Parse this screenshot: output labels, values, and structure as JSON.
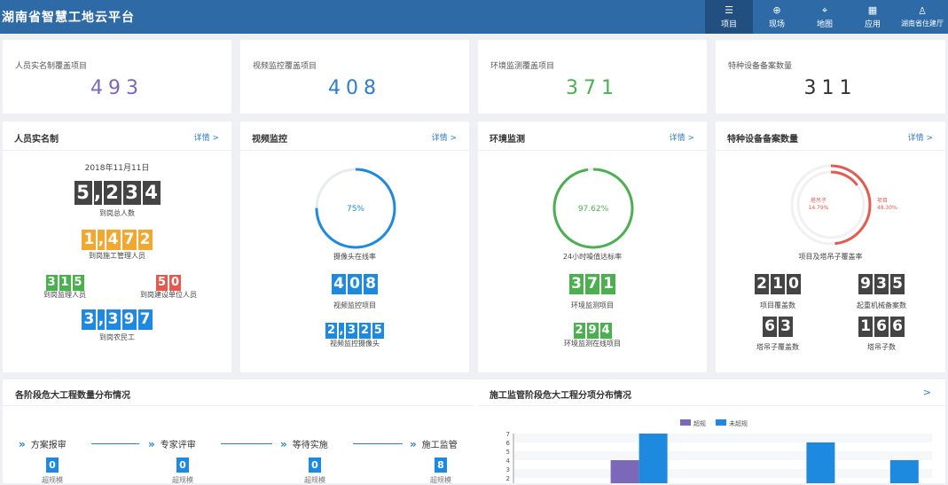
{
  "header": {
    "title": "湖南省智慧工地云平台"
  },
  "nav": [
    {
      "label": "项目",
      "icon": "list-icon",
      "glyph": "☰",
      "active": true
    },
    {
      "label": "现场",
      "icon": "globe-icon",
      "glyph": "⊕",
      "active": false
    },
    {
      "label": "地图",
      "icon": "location-pin-icon",
      "glyph": "⌖",
      "active": false
    },
    {
      "label": "应用",
      "icon": "apps-grid-icon",
      "glyph": "▦",
      "active": false
    },
    {
      "label": "湖南省住建厅",
      "icon": "user-icon",
      "glyph": "♙",
      "active": false
    }
  ],
  "stats": [
    {
      "label": "人员实名制覆盖项目",
      "value": "493",
      "color": "#7b68b8"
    },
    {
      "label": "视频监控覆盖项目",
      "value": "408",
      "color": "#2d7dd2"
    },
    {
      "label": "环境监测覆盖项目",
      "value": "371",
      "color": "#4caf50"
    },
    {
      "label": "特种设备备案数量",
      "value": "311",
      "color": "#333333"
    }
  ],
  "panels": {
    "realname": {
      "title": "人员实名制",
      "more": "详情 >",
      "date": "2018年11月11日",
      "total": {
        "digits": [
          "5",
          ",",
          "2",
          "3",
          "4"
        ],
        "label": "到岗总人数",
        "color": "#444444"
      },
      "mgmt": {
        "digits": [
          "1",
          ",",
          "4",
          "7",
          "2"
        ],
        "label": "到岗施工管理人员",
        "color": "#f0a830"
      },
      "supervisor": {
        "digits": [
          "3",
          "1",
          "5"
        ],
        "label": "到岗监理人员",
        "color": "#4caf50"
      },
      "owner": {
        "digits": [
          "5",
          "0"
        ],
        "label": "到岗建设单位人员",
        "color": "#e55a4f"
      },
      "workers": {
        "digits": [
          "3",
          ",",
          "3",
          "9",
          "7"
        ],
        "label": "到岗农民工",
        "color": "#1d8ae0"
      }
    },
    "video": {
      "title": "视频监控",
      "more": "详情 >",
      "ring_value": "75%",
      "ring_label": "摄像头在线率",
      "ring_fraction": 0.75,
      "ring_color": "#1d8ae0",
      "projects": {
        "digits": [
          "4",
          "0",
          "8"
        ],
        "label": "视频监控项目"
      },
      "cameras": {
        "digits": [
          "2",
          ",",
          "3",
          "2",
          "5"
        ],
        "label": "视频监控摄像头"
      }
    },
    "env": {
      "title": "环境监测",
      "more": "详情 >",
      "ring_value": "97.62%",
      "ring_label": "24小时噪值达标率",
      "ring_fraction": 0.9762,
      "ring_color": "#4caf50",
      "projects": {
        "digits": [
          "3",
          "7",
          "1"
        ],
        "label": "环境监测项目"
      },
      "online": {
        "digits": [
          "2",
          "9",
          "4"
        ],
        "label": "环境监测在线项目"
      }
    },
    "equip": {
      "title": "特种设备备案数量",
      "more": "详情 >",
      "ring_label": "项目及塔吊子覆盖率",
      "inner_label": "塔吊子",
      "inner_value": "14.79%",
      "outer_label": "项目",
      "outer_value": "48.30%",
      "outer_fraction": 0.483,
      "inner_fraction": 0.1479,
      "ring_color": "#e55a4f",
      "cells": [
        {
          "digits": [
            "2",
            "1",
            "0"
          ],
          "label": "项目覆盖数"
        },
        {
          "digits": [
            "9",
            "3",
            "5"
          ],
          "label": "起重机械备案数"
        },
        {
          "digits": [
            "6",
            "3"
          ],
          "label": "塔吊子覆盖数"
        },
        {
          "digits": [
            "1",
            "6",
            "6"
          ],
          "label": "塔吊子数"
        }
      ]
    }
  },
  "bottom_left": {
    "title": "各阶段危大工程数量分布情况",
    "steps": [
      {
        "label": "方案报审",
        "count": "0",
        "sub": "超规模"
      },
      {
        "label": "专家评审",
        "count": "0",
        "sub": "超规模"
      },
      {
        "label": "等待实施",
        "count": "0",
        "sub": "超规模"
      },
      {
        "label": "施工监管",
        "count": "8",
        "sub": "超规模"
      }
    ]
  },
  "bottom_right": {
    "title": "施工监管阶段危大工程分项分布情况",
    "more": ">",
    "chart_data": {
      "type": "bar",
      "series": [
        {
          "name": "超规",
          "color": "#7b68b8",
          "values": [
            0,
            4,
            0,
            0,
            0
          ]
        },
        {
          "name": "未超规",
          "color": "#1d8ae0",
          "values": [
            0,
            7,
            0,
            6,
            4
          ]
        }
      ],
      "categories": [
        "",
        "",
        "",
        "",
        ""
      ],
      "ylim": [
        0,
        7
      ],
      "yticks": [
        "7",
        "6",
        "5",
        "4",
        "3"
      ],
      "legend": "top-center"
    }
  }
}
